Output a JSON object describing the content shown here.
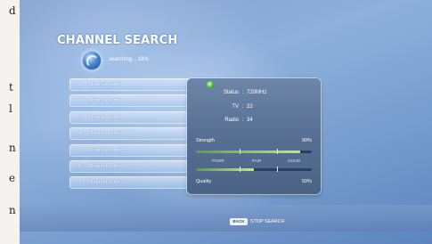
{
  "page": {
    "title": "CHANNEL SEARCH",
    "status": "searching... 18%",
    "progress_percent": 18
  },
  "channels": [
    {
      "num": "1",
      "label": "Channel name"
    },
    {
      "num": "2",
      "label": "Channel name"
    },
    {
      "num": "3",
      "label": "Channel name"
    },
    {
      "num": "4",
      "label": "Channel name"
    },
    {
      "num": "5",
      "label": "Channel name"
    },
    {
      "num": "6",
      "label": "Channel name"
    },
    {
      "num": "7",
      "label": "Channel name"
    }
  ],
  "info": {
    "status_label": "Status",
    "status_value": "720MHz",
    "tv_label": "TV",
    "tv_value": "22",
    "radio_label": "Radio",
    "radio_value": "34",
    "strength_label": "Strength",
    "strength_value": "90%",
    "strength_fraction": 0.9,
    "poor_label": "POOR",
    "fair_label": "FAIR",
    "good_label": "GOOD",
    "quality_label": "Quality",
    "quality_value": "50%",
    "quality_fraction": 0.5
  },
  "footer": {
    "back_label": "BACK",
    "stop_label": "STOP SEARCH"
  },
  "margin": {
    "chars": [
      "d",
      "t",
      "l",
      "n",
      "e",
      "n"
    ]
  },
  "colors": {
    "screen_blue": "#7f9cc9",
    "panel": "#566f92",
    "meter_fill": "#c7e86b"
  },
  "icons": {
    "scan": "globe-icon",
    "status": "status-dot-icon"
  }
}
